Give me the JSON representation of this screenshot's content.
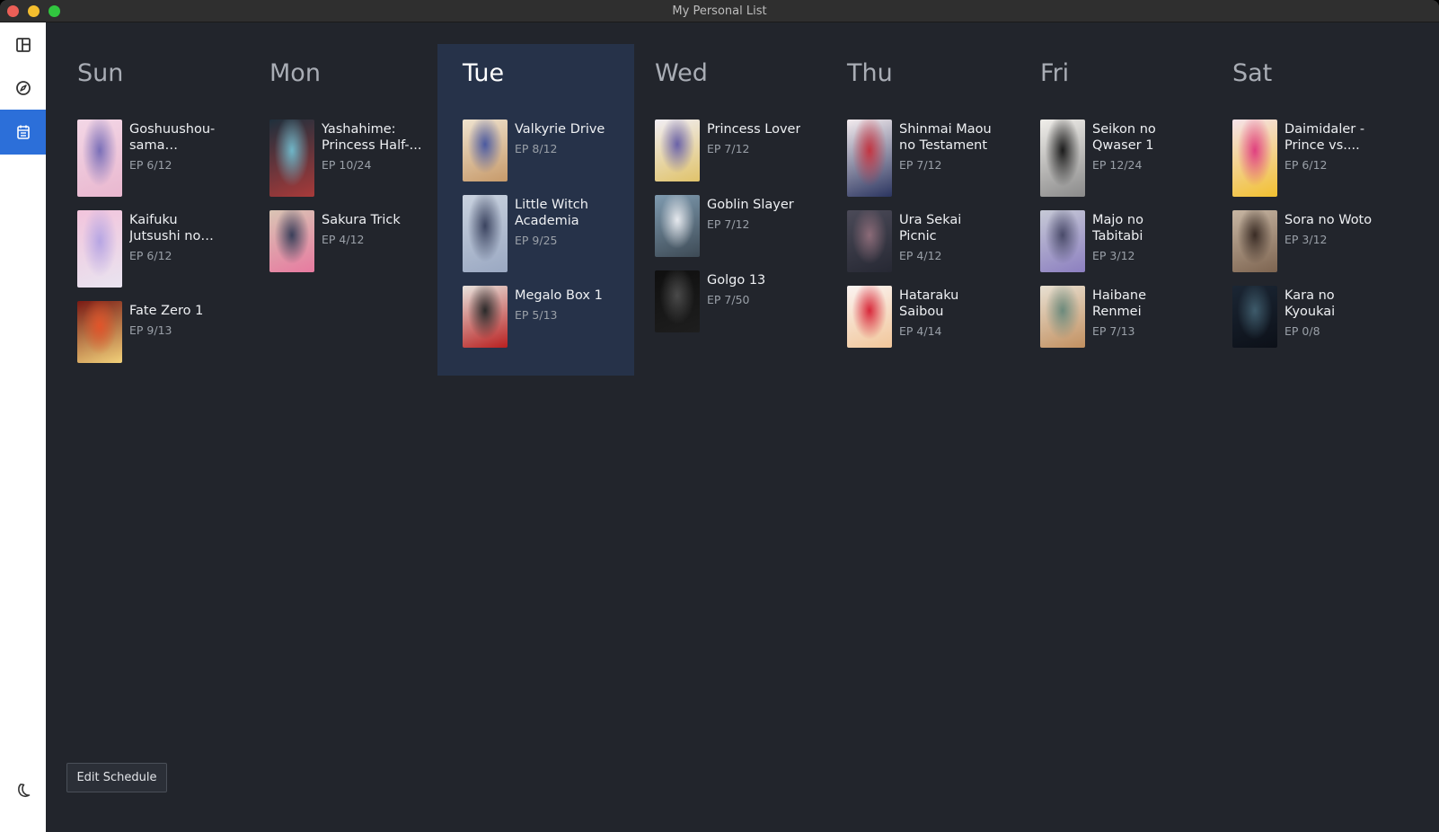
{
  "window": {
    "title": "My Personal List"
  },
  "sidebar": {
    "items": [
      {
        "name": "dashboard-icon"
      },
      {
        "name": "compass-icon"
      },
      {
        "name": "calendar-icon",
        "active": true
      }
    ],
    "theme_icon": "moon-icon"
  },
  "schedule": {
    "today": "Tue",
    "days": [
      {
        "name": "Sun",
        "shows": [
          {
            "title": "Goshuushou-sama Ninomiya-...",
            "ep": "EP 6/12",
            "colors": [
              "#f3d7e6",
              "#7a6fb8",
              "#e9b7cf"
            ]
          },
          {
            "title": "Kaifuku Jutsushi no Yarinaoshi",
            "ep": "EP 6/12",
            "colors": [
              "#f2c4dc",
              "#b6a5e3",
              "#e9e4f0"
            ]
          },
          {
            "title": "Fate Zero 1",
            "ep": "EP 9/13",
            "colors": [
              "#7a1a14",
              "#e1542a",
              "#f2d27a"
            ]
          }
        ]
      },
      {
        "name": "Mon",
        "shows": [
          {
            "title": "Yashahime: Princess Half-...",
            "ep": "EP 10/24",
            "colors": [
              "#1f2f3c",
              "#6fb6c8",
              "#a83a3a"
            ]
          },
          {
            "title": "Sakura Trick",
            "ep": "EP 4/12",
            "colors": [
              "#d9c4b4",
              "#3a3f5a",
              "#e77aa0"
            ]
          }
        ]
      },
      {
        "name": "Tue",
        "shows": [
          {
            "title": "Valkyrie Drive",
            "ep": "EP 8/12",
            "colors": [
              "#efe3cf",
              "#4b5aa0",
              "#c79a6a"
            ]
          },
          {
            "title": "Little Witch Academia",
            "ep": "EP 9/25",
            "colors": [
              "#c9d2df",
              "#3b4460",
              "#9aa8c2"
            ]
          },
          {
            "title": "Megalo Box 1",
            "ep": "EP 5/13",
            "colors": [
              "#e8e3dd",
              "#2a2a2a",
              "#b82020"
            ]
          }
        ]
      },
      {
        "name": "Wed",
        "shows": [
          {
            "title": "Princess Lover",
            "ep": "EP 7/12",
            "colors": [
              "#f1eef4",
              "#6a62a8",
              "#e0c36a"
            ]
          },
          {
            "title": "Goblin Slayer",
            "ep": "EP 7/12",
            "colors": [
              "#7f9bb0",
              "#e6e9ee",
              "#3d4a55"
            ]
          },
          {
            "title": "Golgo 13",
            "ep": "EP 7/50",
            "colors": [
              "#0f0f0f",
              "#4a4a4a",
              "#1e1e1e"
            ]
          }
        ]
      },
      {
        "name": "Thu",
        "shows": [
          {
            "title": "Shinmai Maou no Testament",
            "ep": "EP 7/12",
            "colors": [
              "#f4ecef",
              "#c23542",
              "#2b3560"
            ]
          },
          {
            "title": "Ura Sekai Picnic",
            "ep": "EP 4/12",
            "colors": [
              "#4b4a58",
              "#8b6b78",
              "#262833"
            ]
          },
          {
            "title": "Hataraku Saibou",
            "ep": "EP 4/14",
            "colors": [
              "#fbf4f2",
              "#d8283a",
              "#f1c69a"
            ]
          }
        ]
      },
      {
        "name": "Fri",
        "shows": [
          {
            "title": "Seikon no Qwaser 1",
            "ep": "EP 12/24",
            "colors": [
              "#f0eeea",
              "#1b1b1b",
              "#8a8a8a"
            ]
          },
          {
            "title": "Majo no Tabitabi",
            "ep": "EP 3/12",
            "colors": [
              "#c6c9d6",
              "#4a4b6a",
              "#8c7fc0"
            ]
          },
          {
            "title": "Haibane Renmei",
            "ep": "EP 7/13",
            "colors": [
              "#e8e0d2",
              "#6c8a7c",
              "#c29060"
            ]
          }
        ]
      },
      {
        "name": "Sat",
        "shows": [
          {
            "title": "Daimidaler - Prince vs....",
            "ep": "EP 6/12",
            "colors": [
              "#f6e3ea",
              "#e04080",
              "#f1c030"
            ]
          },
          {
            "title": "Sora no Woto",
            "ep": "EP 3/12",
            "colors": [
              "#c7b6a3",
              "#3a2c25",
              "#7d6450"
            ]
          },
          {
            "title": "Kara no Kyoukai",
            "ep": "EP 0/8",
            "colors": [
              "#1b2634",
              "#3e5b6b",
              "#0c1018"
            ]
          }
        ]
      }
    ]
  },
  "footer": {
    "edit_button": "Edit Schedule"
  }
}
